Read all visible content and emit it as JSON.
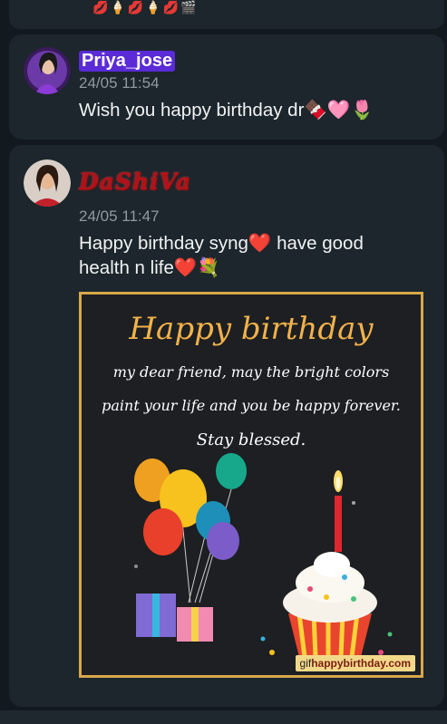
{
  "previous_message": {
    "emoji_strip": "💋🍦💋🍦💋🎬"
  },
  "messages": [
    {
      "username": "Priya_jose",
      "timestamp": "24/05 11:54",
      "text": "Wish you happy birthday dr🍫🩷🌷"
    },
    {
      "username": "DaShiVa",
      "timestamp": "24/05 11:47",
      "text_line1": "Happy birthday syng❤️ have good",
      "text_line2": "health n life❤️💐",
      "gif": {
        "title": "Happy birthday",
        "line1": "my dear friend, may the bright colors",
        "line2": "paint your life and you be happy forever.",
        "line3": "Stay blessed.",
        "watermark_prefix": "gif",
        "watermark_suffix": "happybirthday.com"
      }
    }
  ],
  "colors": {
    "background": "#121a1f",
    "card": "#1c262c",
    "username_highlight": "#5a2bd6",
    "gif_border": "#d8a84a"
  }
}
